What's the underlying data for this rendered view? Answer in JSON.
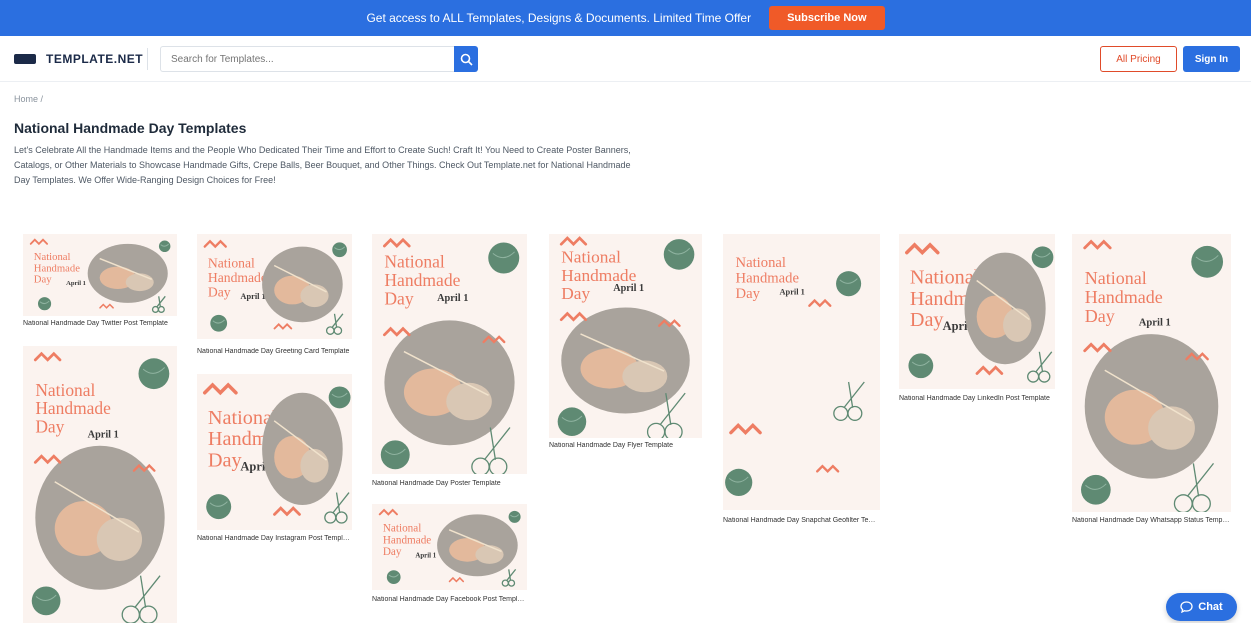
{
  "promo": {
    "text": "Get access to ALL Templates, Designs & Documents. Limited Time Offer",
    "button": "Subscribe Now"
  },
  "header": {
    "logo": "TEMPLATE.NET",
    "search_placeholder": "Search for Templates...",
    "pricing": "All Pricing",
    "signin": "Sign In"
  },
  "breadcrumb": "Home /",
  "page_title": "National Handmade Day Templates",
  "description": "Let's Celebrate All the Handmade Items and the People Who Dedicated Their Time and Effort to Create Such! Craft It! You Need to Create Poster Banners, Catalogs, or Other Materials to Showcase Handmade Gifts, Crepe Balls, Beer Bouquet, and Other Things. Check Out Template.net for National Handmade Day Templates. We Offer Wide-Ranging Design Choices for Free!",
  "poster": {
    "line1": "National",
    "line2": "Handmade",
    "line3": "Day",
    "date": "April 1"
  },
  "cards": [
    {
      "title": "National Handmade Day Twitter Post Template",
      "variant": "landscape"
    },
    {
      "title": "National Handmade Day Greeting Card Template",
      "variant": "landscape"
    },
    {
      "title": "National Handmade Day Instagram Post Template",
      "variant": "landscape"
    },
    {
      "title": "National Handmade Day Poster Template",
      "variant": "portrait"
    },
    {
      "title": "National Handmade Day Facebook Post Template",
      "variant": "landscape"
    },
    {
      "title": "National Handmade Day Flyer Template",
      "variant": "portrait"
    },
    {
      "title": "National Handmade Day Snapchat Geofilter Template",
      "variant": "blank"
    },
    {
      "title": "National Handmade Day LinkedIn Post Template",
      "variant": "landscape"
    },
    {
      "title": "National Handmade Day Whatsapp Status Template",
      "variant": "tall"
    },
    {
      "title": "",
      "variant": "tall"
    }
  ],
  "chat": "Chat",
  "colors": {
    "brand_blue": "#2b6fe0",
    "accent_orange": "#f05a28",
    "poster_coral": "#ee7d63",
    "poster_green": "#5f8a73",
    "poster_bg": "#fbf3ef"
  },
  "icons": {
    "search": "magnifier-icon",
    "chat": "chat-bubble-icon",
    "logo": "logo-mark-icon"
  }
}
